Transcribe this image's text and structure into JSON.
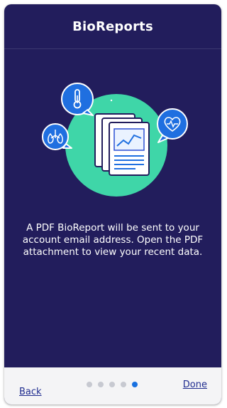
{
  "header": {
    "title": "BioReports"
  },
  "content": {
    "message": "A PDF BioReport will be sent to your account email address. Open the PDF attachment to view your recent data."
  },
  "footer": {
    "back_label": "Back",
    "done_label": "Done",
    "pagination": {
      "total": 5,
      "active": 5
    }
  },
  "colors": {
    "background": "#221d5c",
    "accent_circle": "#3fd6a8",
    "bubble": "#1f6fe0",
    "active_dot": "#1870e0",
    "inactive_dot": "#c7c9d1",
    "link": "#1f2c8f"
  },
  "icons": [
    "thermometer-icon",
    "lungs-icon",
    "heart-pulse-icon",
    "pdf-report-icon"
  ]
}
